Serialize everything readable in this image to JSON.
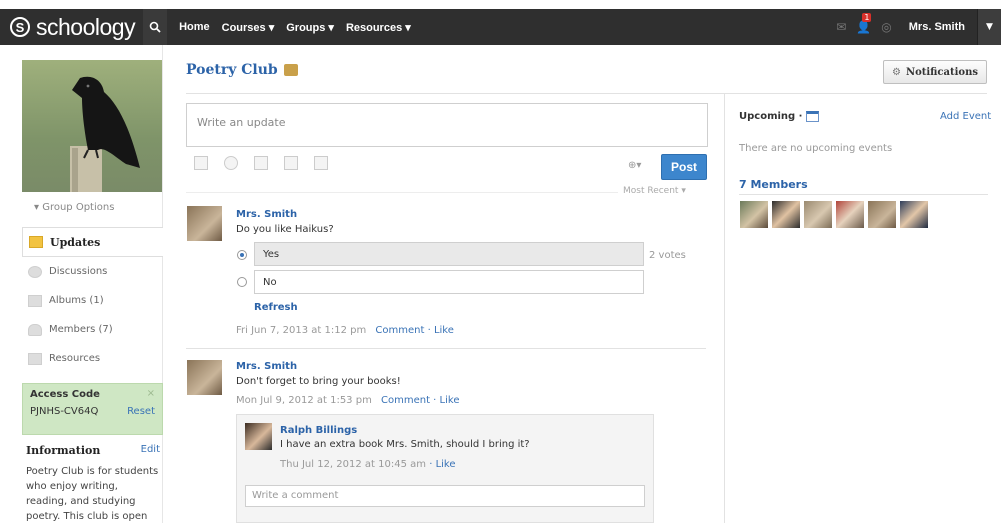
{
  "nav": {
    "logo_mark": "S",
    "logo_text": "schoology",
    "items": [
      "Home",
      "Courses ▾",
      "Groups ▾",
      "Resources ▾"
    ],
    "notification_count": "1",
    "user": "Mrs. Smith"
  },
  "left": {
    "group_options": "▾ Group Options",
    "items": [
      {
        "label": "Updates"
      },
      {
        "label": "Discussions"
      },
      {
        "label": "Albums (1)"
      },
      {
        "label": "Members (7)"
      },
      {
        "label": "Resources"
      }
    ],
    "access": {
      "title": "Access Code",
      "code": "PJNHS-CV64Q",
      "reset": "Reset",
      "close": "×"
    },
    "info": {
      "title": "Information",
      "edit": "Edit",
      "text": "Poetry Club is for students who enjoy writing, reading, and studying poetry. This club is open to everyone."
    }
  },
  "main": {
    "title": "Poetry Club",
    "notifications_button": "Notifications",
    "composer_placeholder": "Write an update",
    "post_button": "Post",
    "sort": "Most Recent ▾",
    "posts": [
      {
        "author": "Mrs. Smith",
        "text": "Do you like Haikus?",
        "poll": [
          {
            "label": "Yes",
            "selected": true
          },
          {
            "label": "No",
            "selected": false
          }
        ],
        "votes": "2 votes",
        "refresh": "Refresh",
        "date": "Fri Jun 7, 2013 at 1:12 pm",
        "comment": "Comment",
        "like": "Like"
      },
      {
        "author": "Mrs. Smith",
        "text": "Don't forget to bring your books!",
        "date": "Mon Jul 9, 2012 at 1:53 pm",
        "comment": "Comment",
        "like": "Like",
        "reply": {
          "author": "Ralph Billings",
          "text": "I have an extra book Mrs. Smith, should I bring it?",
          "date": "Thu Jul 12, 2012 at 10:45 am",
          "like": "Like"
        },
        "comment_placeholder": "Write a comment"
      }
    ]
  },
  "right": {
    "upcoming": "Upcoming ·",
    "add_event": "Add Event",
    "no_events": "There are no upcoming events",
    "members_title": "7 Members"
  },
  "colors": {
    "accent": "#2c63a8",
    "post_button": "#3d86cd",
    "topbar": "#2f2f2f",
    "access_bg": "#cfe7c4"
  }
}
